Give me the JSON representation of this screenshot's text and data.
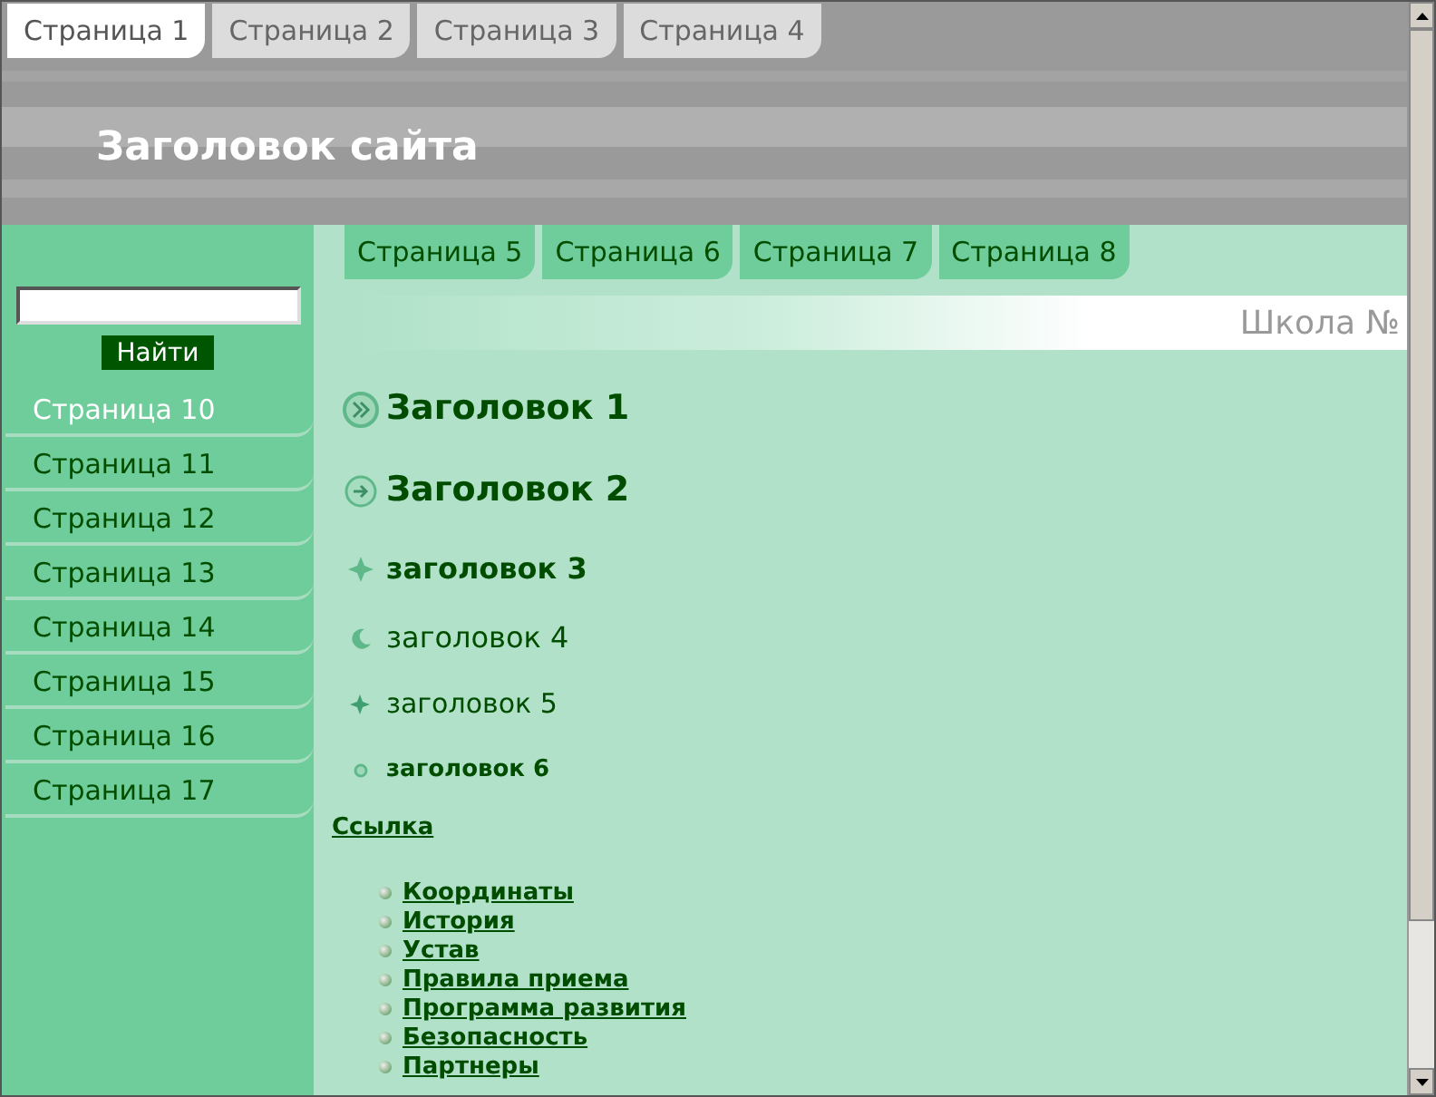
{
  "top_tabs": [
    {
      "label": "Страница 1",
      "selected": true
    },
    {
      "label": "Страница 2",
      "selected": false
    },
    {
      "label": "Страница 3",
      "selected": false
    },
    {
      "label": "Страница 4",
      "selected": false
    }
  ],
  "header": {
    "title": "Заголовок сайта"
  },
  "search": {
    "button": "Найти"
  },
  "sidebar": {
    "items": [
      {
        "label": "Страница 10",
        "selected": true
      },
      {
        "label": "Страница 11",
        "selected": false
      },
      {
        "label": "Страница 12",
        "selected": false
      },
      {
        "label": "Страница 13",
        "selected": false
      },
      {
        "label": "Страница 14",
        "selected": false
      },
      {
        "label": "Страница 15",
        "selected": false
      },
      {
        "label": "Страница 16",
        "selected": false
      },
      {
        "label": "Страница 17",
        "selected": false
      }
    ]
  },
  "content_tabs": [
    {
      "label": "Страница 5"
    },
    {
      "label": "Страница 6"
    },
    {
      "label": "Страница 7"
    },
    {
      "label": "Страница 8"
    }
  ],
  "banner": {
    "text": "Школа №"
  },
  "headings": [
    {
      "kind": "h1",
      "text": "Заголовок 1"
    },
    {
      "kind": "h2",
      "text": "Заголовок 2"
    },
    {
      "kind": "h3",
      "text": "заголовок 3"
    },
    {
      "kind": "h4",
      "text": "заголовок 4"
    },
    {
      "kind": "h5",
      "text": "заголовок 5"
    },
    {
      "kind": "h6",
      "text": "заголовок 6"
    }
  ],
  "link": "Ссылка",
  "links": [
    "Координаты",
    "История",
    "Устав",
    "Правила приема",
    "Программа развития",
    "Безопасность",
    "Партнеры"
  ]
}
